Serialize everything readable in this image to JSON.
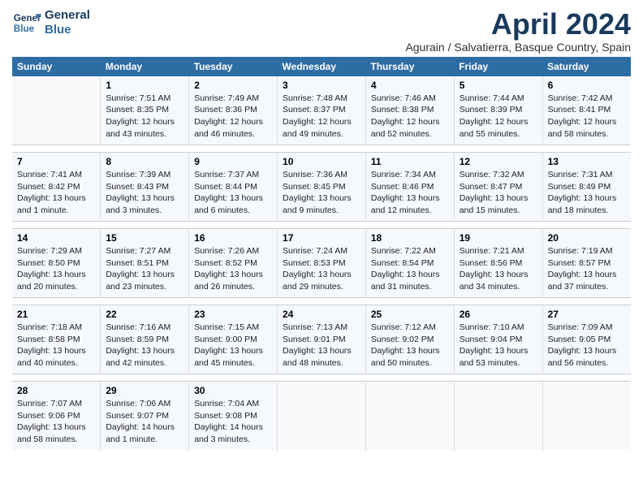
{
  "header": {
    "logo_line1": "General",
    "logo_line2": "Blue",
    "title": "April 2024",
    "subtitle": "Agurain / Salvatierra, Basque Country, Spain"
  },
  "days_of_week": [
    "Sunday",
    "Monday",
    "Tuesday",
    "Wednesday",
    "Thursday",
    "Friday",
    "Saturday"
  ],
  "weeks": [
    [
      {
        "day": "",
        "info": ""
      },
      {
        "day": "1",
        "info": "Sunrise: 7:51 AM\nSunset: 8:35 PM\nDaylight: 12 hours\nand 43 minutes."
      },
      {
        "day": "2",
        "info": "Sunrise: 7:49 AM\nSunset: 8:36 PM\nDaylight: 12 hours\nand 46 minutes."
      },
      {
        "day": "3",
        "info": "Sunrise: 7:48 AM\nSunset: 8:37 PM\nDaylight: 12 hours\nand 49 minutes."
      },
      {
        "day": "4",
        "info": "Sunrise: 7:46 AM\nSunset: 8:38 PM\nDaylight: 12 hours\nand 52 minutes."
      },
      {
        "day": "5",
        "info": "Sunrise: 7:44 AM\nSunset: 8:39 PM\nDaylight: 12 hours\nand 55 minutes."
      },
      {
        "day": "6",
        "info": "Sunrise: 7:42 AM\nSunset: 8:41 PM\nDaylight: 12 hours\nand 58 minutes."
      }
    ],
    [
      {
        "day": "7",
        "info": "Sunrise: 7:41 AM\nSunset: 8:42 PM\nDaylight: 13 hours\nand 1 minute."
      },
      {
        "day": "8",
        "info": "Sunrise: 7:39 AM\nSunset: 8:43 PM\nDaylight: 13 hours\nand 3 minutes."
      },
      {
        "day": "9",
        "info": "Sunrise: 7:37 AM\nSunset: 8:44 PM\nDaylight: 13 hours\nand 6 minutes."
      },
      {
        "day": "10",
        "info": "Sunrise: 7:36 AM\nSunset: 8:45 PM\nDaylight: 13 hours\nand 9 minutes."
      },
      {
        "day": "11",
        "info": "Sunrise: 7:34 AM\nSunset: 8:46 PM\nDaylight: 13 hours\nand 12 minutes."
      },
      {
        "day": "12",
        "info": "Sunrise: 7:32 AM\nSunset: 8:47 PM\nDaylight: 13 hours\nand 15 minutes."
      },
      {
        "day": "13",
        "info": "Sunrise: 7:31 AM\nSunset: 8:49 PM\nDaylight: 13 hours\nand 18 minutes."
      }
    ],
    [
      {
        "day": "14",
        "info": "Sunrise: 7:29 AM\nSunset: 8:50 PM\nDaylight: 13 hours\nand 20 minutes."
      },
      {
        "day": "15",
        "info": "Sunrise: 7:27 AM\nSunset: 8:51 PM\nDaylight: 13 hours\nand 23 minutes."
      },
      {
        "day": "16",
        "info": "Sunrise: 7:26 AM\nSunset: 8:52 PM\nDaylight: 13 hours\nand 26 minutes."
      },
      {
        "day": "17",
        "info": "Sunrise: 7:24 AM\nSunset: 8:53 PM\nDaylight: 13 hours\nand 29 minutes."
      },
      {
        "day": "18",
        "info": "Sunrise: 7:22 AM\nSunset: 8:54 PM\nDaylight: 13 hours\nand 31 minutes."
      },
      {
        "day": "19",
        "info": "Sunrise: 7:21 AM\nSunset: 8:56 PM\nDaylight: 13 hours\nand 34 minutes."
      },
      {
        "day": "20",
        "info": "Sunrise: 7:19 AM\nSunset: 8:57 PM\nDaylight: 13 hours\nand 37 minutes."
      }
    ],
    [
      {
        "day": "21",
        "info": "Sunrise: 7:18 AM\nSunset: 8:58 PM\nDaylight: 13 hours\nand 40 minutes."
      },
      {
        "day": "22",
        "info": "Sunrise: 7:16 AM\nSunset: 8:59 PM\nDaylight: 13 hours\nand 42 minutes."
      },
      {
        "day": "23",
        "info": "Sunrise: 7:15 AM\nSunset: 9:00 PM\nDaylight: 13 hours\nand 45 minutes."
      },
      {
        "day": "24",
        "info": "Sunrise: 7:13 AM\nSunset: 9:01 PM\nDaylight: 13 hours\nand 48 minutes."
      },
      {
        "day": "25",
        "info": "Sunrise: 7:12 AM\nSunset: 9:02 PM\nDaylight: 13 hours\nand 50 minutes."
      },
      {
        "day": "26",
        "info": "Sunrise: 7:10 AM\nSunset: 9:04 PM\nDaylight: 13 hours\nand 53 minutes."
      },
      {
        "day": "27",
        "info": "Sunrise: 7:09 AM\nSunset: 9:05 PM\nDaylight: 13 hours\nand 56 minutes."
      }
    ],
    [
      {
        "day": "28",
        "info": "Sunrise: 7:07 AM\nSunset: 9:06 PM\nDaylight: 13 hours\nand 58 minutes."
      },
      {
        "day": "29",
        "info": "Sunrise: 7:06 AM\nSunset: 9:07 PM\nDaylight: 14 hours\nand 1 minute."
      },
      {
        "day": "30",
        "info": "Sunrise: 7:04 AM\nSunset: 9:08 PM\nDaylight: 14 hours\nand 3 minutes."
      },
      {
        "day": "",
        "info": ""
      },
      {
        "day": "",
        "info": ""
      },
      {
        "day": "",
        "info": ""
      },
      {
        "day": "",
        "info": ""
      }
    ]
  ]
}
